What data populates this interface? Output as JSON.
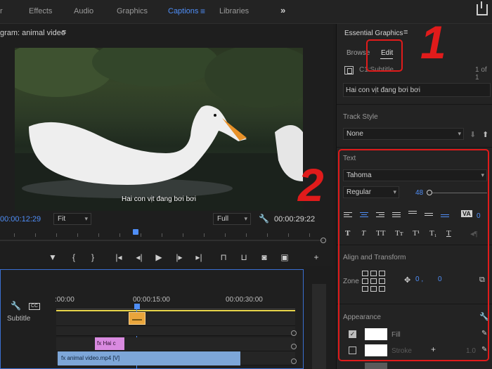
{
  "topbar": {
    "items": [
      "r",
      "Effects",
      "Audio",
      "Graphics",
      "Captions",
      "Libraries"
    ],
    "active": "Captions",
    "menu_glyph": "≡",
    "more_glyph": "»"
  },
  "program": {
    "title": "gram: animal video",
    "menu_glyph": "≡",
    "caption": "Hai con vịt đang bơi bơi",
    "timecode_current": "00:00:12:29",
    "fit": "Fit",
    "quality": "Full",
    "timecode_duration": "00:00:29:22"
  },
  "timeline": {
    "times": [
      ":00:00",
      "00:00:15:00",
      "00:00:30:00"
    ],
    "track_label": "Subtitle",
    "gfx_clip": "Hai c",
    "video_clip": "animal video.mp4 [V]"
  },
  "essential_graphics": {
    "title": "Essential Graphics",
    "menu_glyph": "≡",
    "tabs": [
      "Browse",
      "Edit"
    ],
    "active_tab": "Edit",
    "layer_name": "C1:Subtitle",
    "layer_count": "1 of 1",
    "text_value": "Hai con vịt đang bơi bơi",
    "track_style_label": "Track Style",
    "track_style_value": "None",
    "text_section": "Text",
    "font": "Tahoma",
    "font_style": "Regular",
    "font_size": "48",
    "tracking_value": "0",
    "align_section": "Align and Transform",
    "zone_label": "Zone",
    "pos_x": "0 ,",
    "pos_y": "0",
    "appearance_section": "Appearance",
    "fill_label": "Fill",
    "stroke_label": "Stroke",
    "stroke_width": "1.0"
  },
  "annotations": {
    "step1": "1",
    "step2": "2",
    "color": "#e01b1b"
  }
}
